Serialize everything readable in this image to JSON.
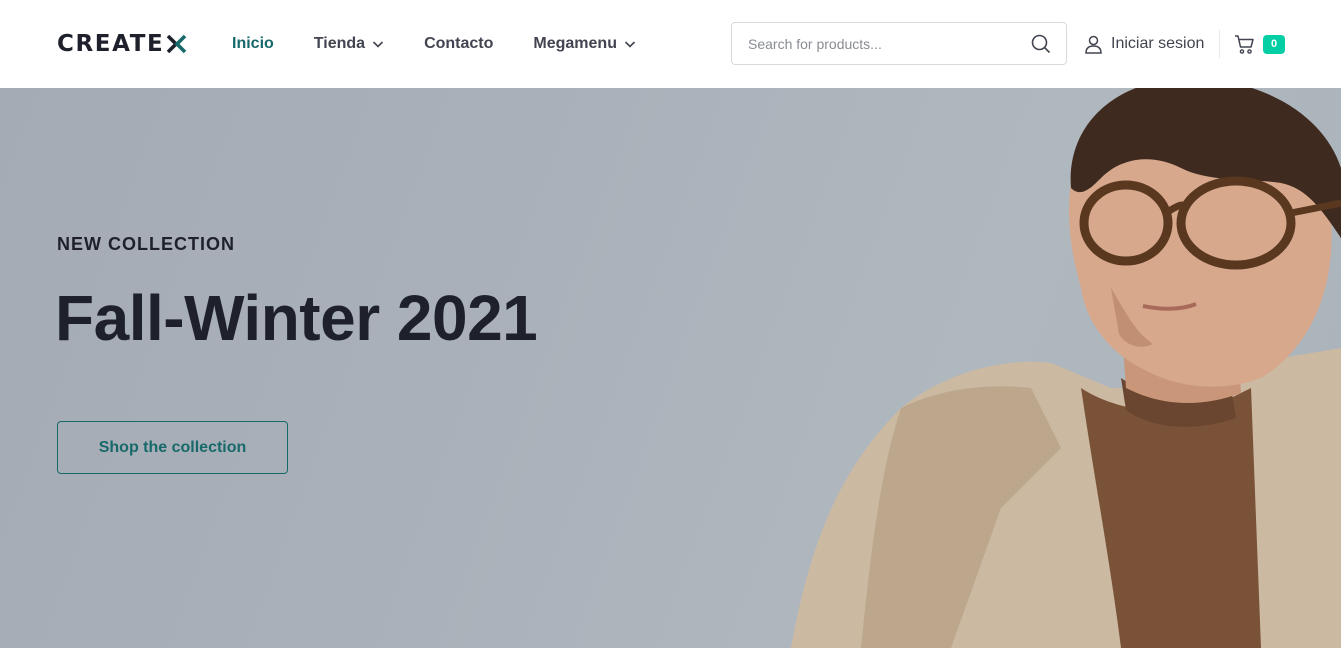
{
  "header": {
    "logo": "CREATE",
    "nav": [
      {
        "label": "Inicio"
      },
      {
        "label": "Tienda"
      },
      {
        "label": "Contacto"
      },
      {
        "label": "Megamenu"
      }
    ],
    "search": {
      "placeholder": "Search for products..."
    },
    "signin_label": "Iniciar sesion",
    "cart_count": "0"
  },
  "hero": {
    "eyebrow": "NEW COLLECTION",
    "title": "Fall-Winter 2021",
    "cta_label": "Shop the collection",
    "countdown": [
      "",
      "",
      "",
      ""
    ]
  },
  "colors": {
    "accent": "#17696a",
    "badge": "#03cea4",
    "hero_bg": "#aab1ba",
    "text": "#1e212c"
  },
  "icons": [
    "chevron-down-icon",
    "search-icon",
    "user-icon",
    "cart-icon"
  ]
}
